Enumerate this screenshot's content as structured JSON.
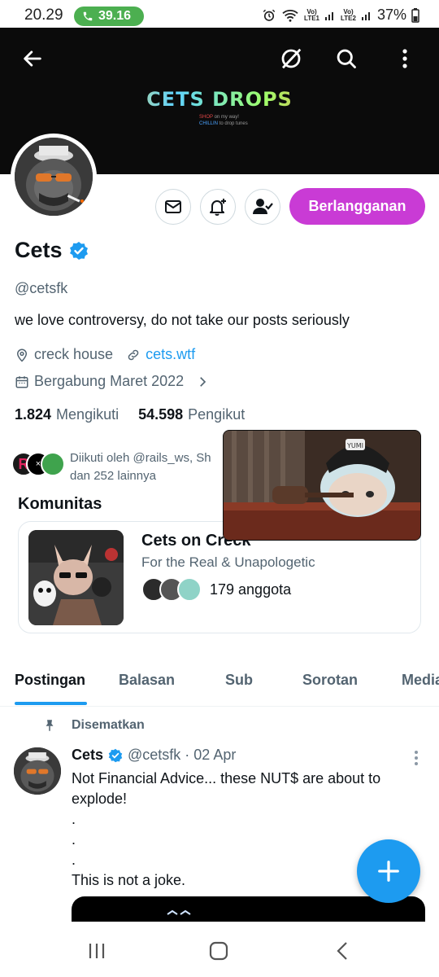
{
  "status": {
    "time": "20.29",
    "call": "39.16",
    "sim1": "Vo) LTE1",
    "sim2": "Vo) LTE2",
    "battery": "37%"
  },
  "banner": {
    "title": "CETS DROPS",
    "sub1_a": "SHOP ",
    "sub1_b": "on my way!",
    "sub2_a": "CHILLIN ",
    "sub2_b": "to drop tunes"
  },
  "profile": {
    "name": "Cets",
    "handle": "@cetsfk",
    "bio": "we love controversy, do not take our posts seriously",
    "location": "creck house",
    "website": "cets.wtf",
    "joined": "Bergabung Maret 2022",
    "following_count": "1.824",
    "following_label": "Mengikuti",
    "followers_count": "54.598",
    "followers_label": "Pengikut",
    "followed_by_line1": "Diikuti oleh @rails_ws, Sh",
    "followed_by_line2": "dan 252 lainnya",
    "subscribe_label": "Berlangganan"
  },
  "community": {
    "heading": "Komunitas",
    "title": "Cets on Creck",
    "subtitle": "For the Real & Unapologetic",
    "members": "179 anggota"
  },
  "pip": {
    "hat_text": "YUMI"
  },
  "tabs": [
    "Postingan",
    "Balasan",
    "Sub",
    "Sorotan",
    "Media"
  ],
  "post": {
    "pinned_label": "Disematkan",
    "author": "Cets",
    "meta": "@cetsfk · 02 Apr",
    "body": "Not Financial Advice... these NUT$ are about to explode!\n.\n.\n.\nThis is not a joke."
  },
  "colors": {
    "accent": "#1d9bf0",
    "subscribe": "#c93bd5",
    "call_pill": "#4caf50"
  }
}
